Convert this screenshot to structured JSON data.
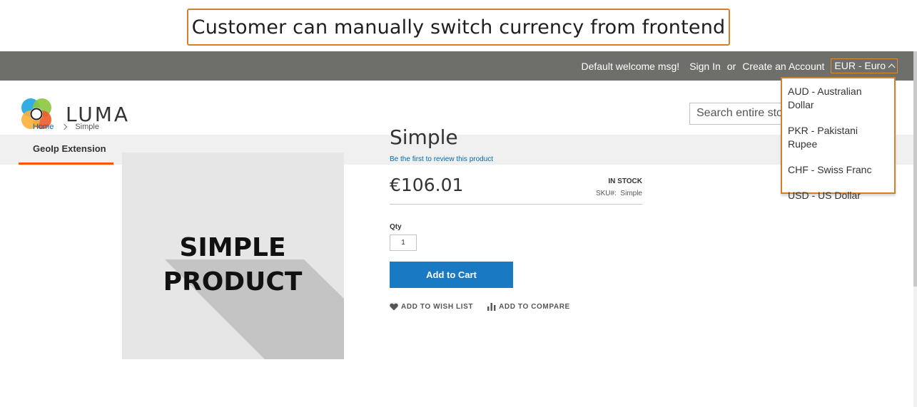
{
  "banner": {
    "text": "Customer can manually switch currency from frontend"
  },
  "header": {
    "welcome": "Default welcome msg!",
    "sign_in": "Sign In",
    "or": "or",
    "create_account": "Create an Account",
    "currency_selected": "EUR - Euro"
  },
  "currency_options": [
    "AUD - Australian Dollar",
    "PKR - Pakistani Rupee",
    "CHF - Swiss Franc",
    "USD - US Dollar"
  ],
  "logo": {
    "text": "LUMA"
  },
  "search": {
    "placeholder": "Search entire store here..."
  },
  "nav": {
    "item": "GeoIp Extension"
  },
  "breadcrumbs": {
    "home": "Home",
    "current": "Simple"
  },
  "product": {
    "image_line1": "SIMPLE",
    "image_line2": "PRODUCT",
    "title": "Simple",
    "review_link": "Be the first to review this product",
    "price": "€106.01",
    "stock": "IN STOCK",
    "sku_label": "SKU#:",
    "sku_value": "Simple",
    "qty_label": "Qty",
    "qty_value": "1",
    "add_to_cart": "Add to Cart",
    "wishlist": "ADD TO WISH LIST",
    "compare": "ADD TO COMPARE"
  },
  "colors": {
    "accent_orange": "#d4802a",
    "button_blue": "#1979c3",
    "link_blue": "#006bb4",
    "header_bar": "#6e6e6b"
  }
}
